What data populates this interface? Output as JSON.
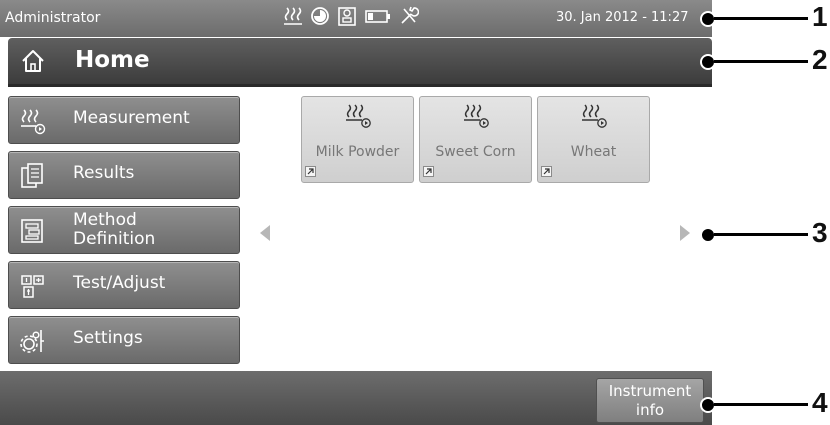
{
  "status_bar": {
    "user": "Administrator",
    "icons": [
      "heating-icon",
      "time-switch-icon",
      "balance-icon",
      "battery-icon",
      "tools-icon"
    ],
    "datetime": "30. Jan 2012 - 11:27"
  },
  "title_bar": {
    "title": "Home",
    "icon": "home-icon"
  },
  "nav": {
    "items": [
      {
        "label": "Measurement",
        "icon": "measurement-icon"
      },
      {
        "label": "Results",
        "icon": "results-icon"
      },
      {
        "label": "Method\nDefinition",
        "icon": "method-definition-icon"
      },
      {
        "label": "Test/Adjust",
        "icon": "test-adjust-icon"
      },
      {
        "label": "Settings",
        "icon": "settings-icon"
      }
    ]
  },
  "shortcuts": [
    {
      "label": "Milk Powder"
    },
    {
      "label": "Sweet Corn"
    },
    {
      "label": "Wheat"
    }
  ],
  "bottom_bar": {
    "instrument_info_label": "Instrument\ninfo"
  },
  "callouts": [
    "1",
    "2",
    "3",
    "4"
  ]
}
